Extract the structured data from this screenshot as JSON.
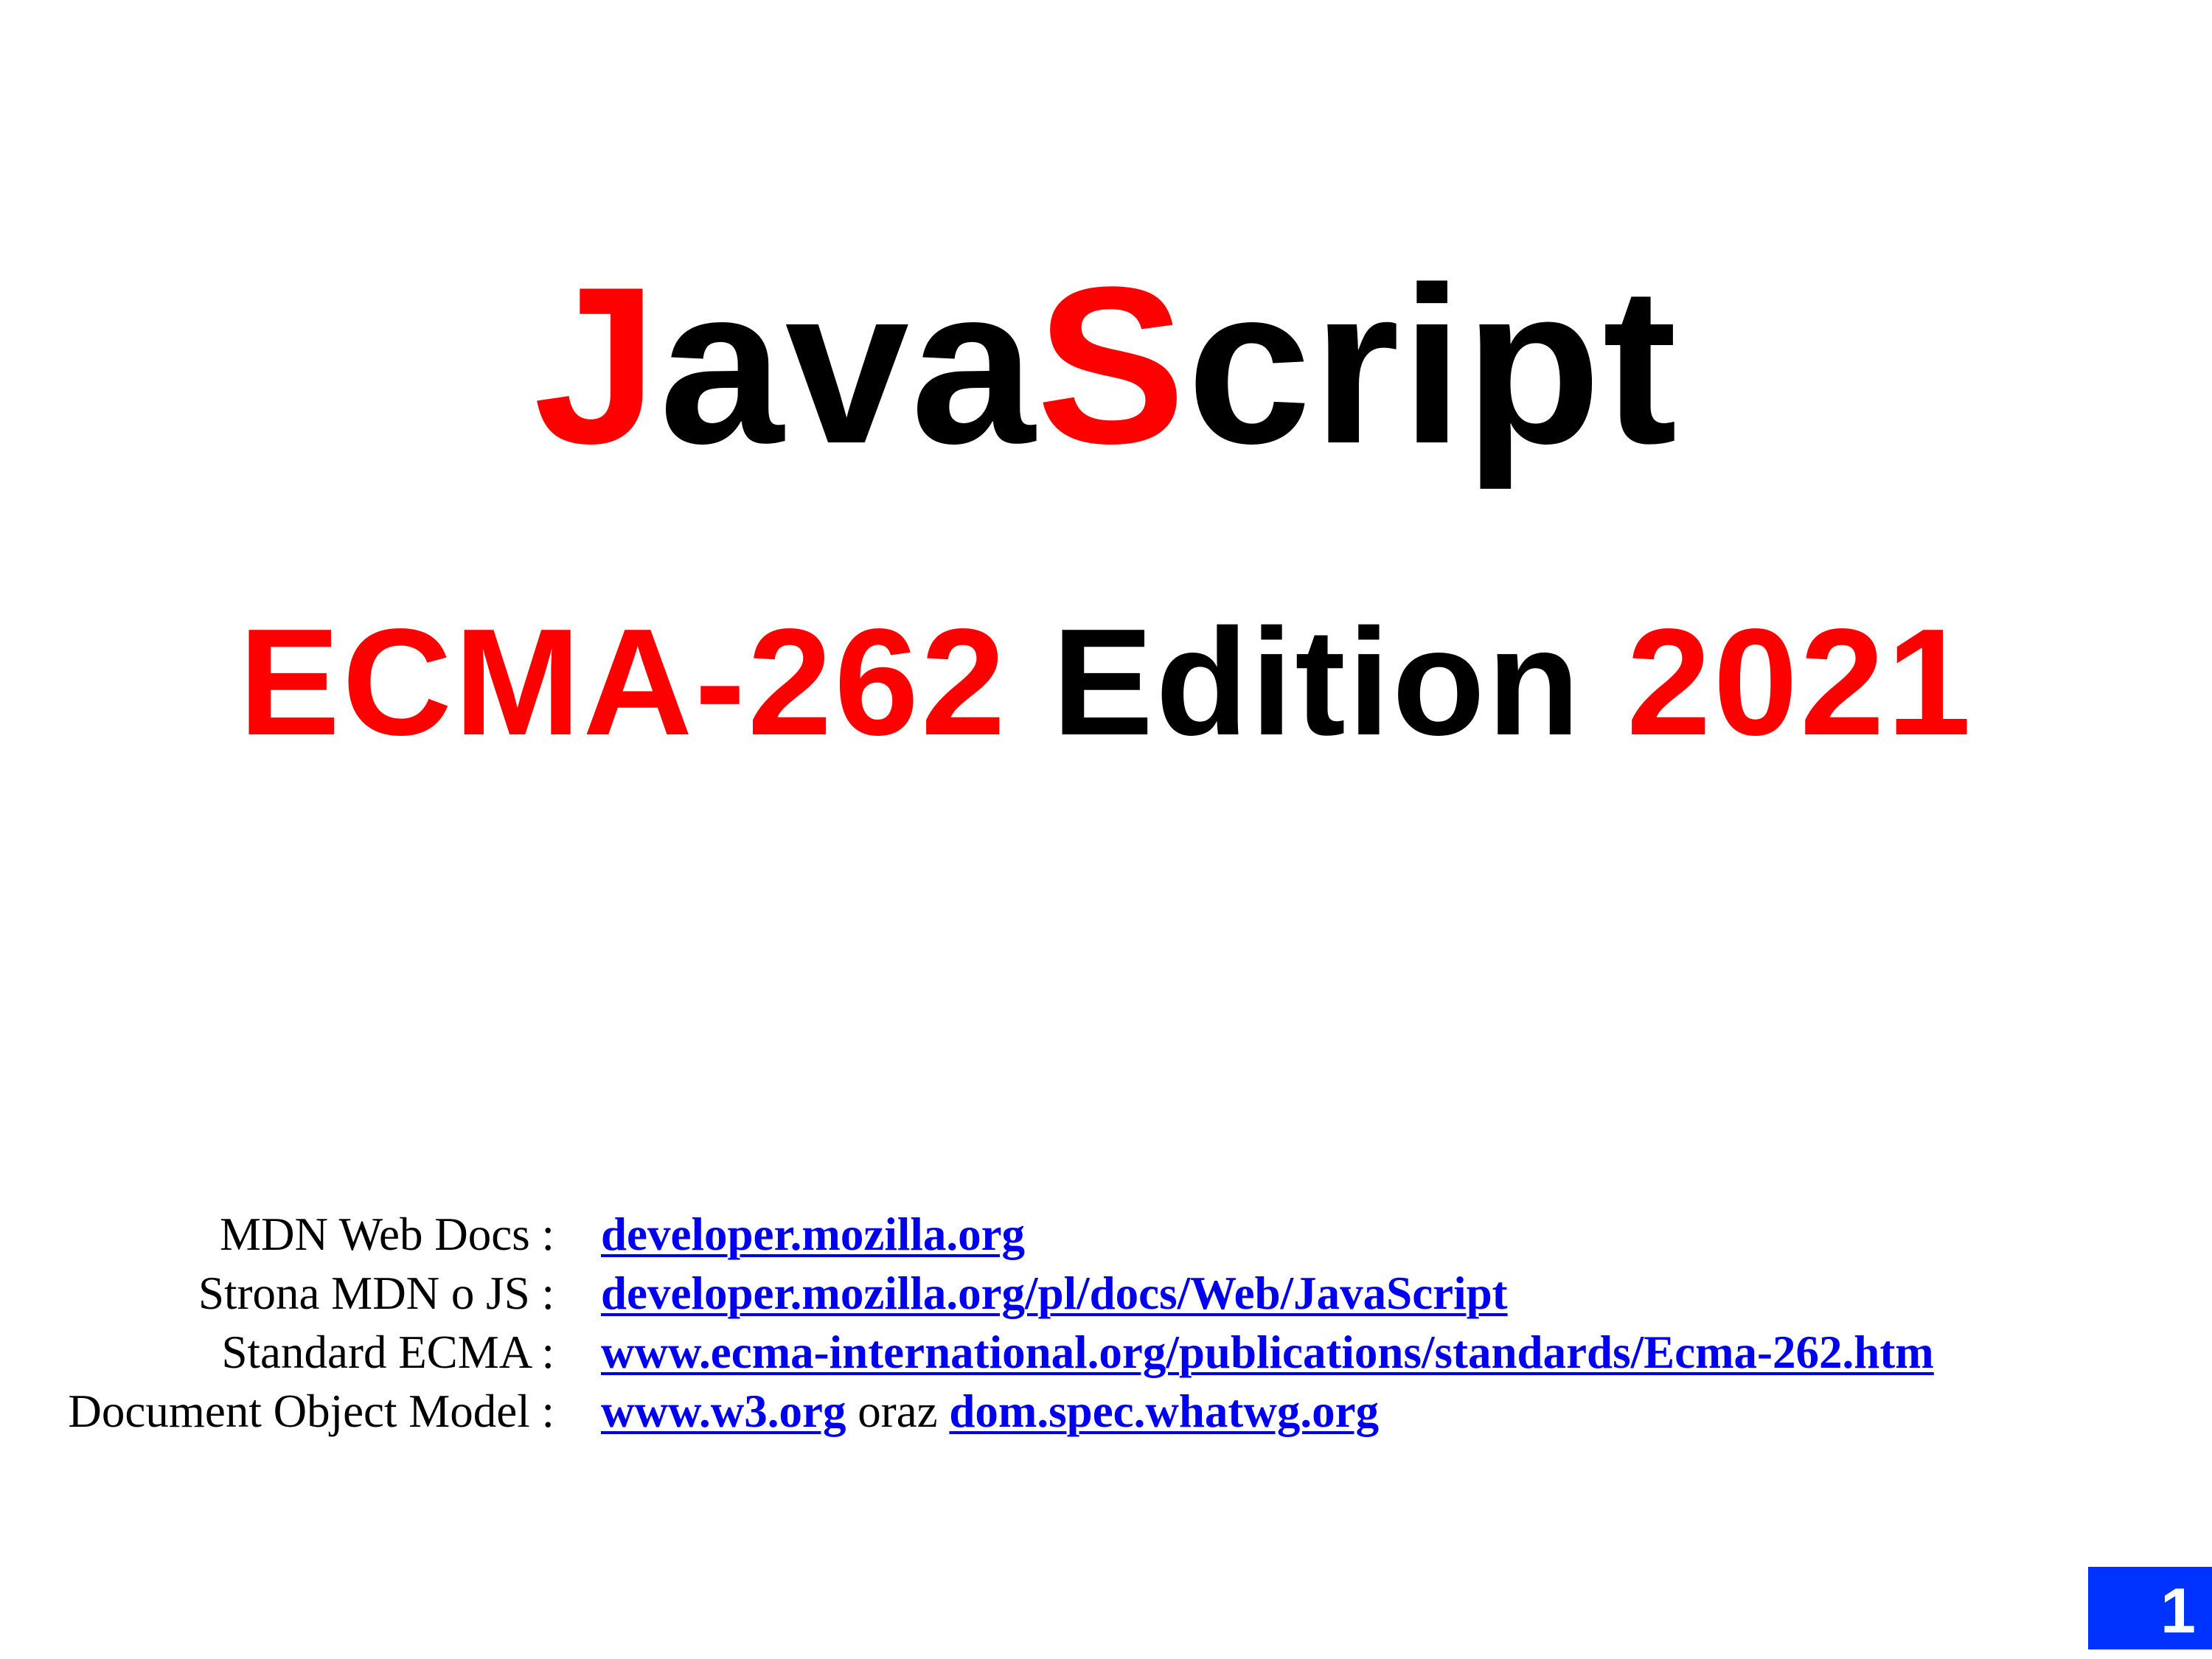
{
  "title": {
    "j": "J",
    "ava": "ava",
    "s": "S",
    "cript": "cript"
  },
  "subtitle": {
    "ecma": "ECMA-262",
    "edition": "Edition",
    "year": "2021"
  },
  "links": [
    {
      "label": "MDN Web Docs :",
      "url": "developer.mozilla.org"
    },
    {
      "label": "Strona MDN o JS :",
      "url": "developer.mozilla.org/pl/docs/Web/JavaScript"
    },
    {
      "label": "Standard ECMA :",
      "url": "www.ecma-international.org/publications/standards/Ecma-262.htm"
    },
    {
      "label": "Document Object Model :",
      "url": "www.w3.org",
      "connector": "oraz",
      "url2": "dom.spec.whatwg.org"
    }
  ],
  "page_number": "1",
  "colors": {
    "accent": "#ff0000",
    "text": "#000000",
    "link": "#0000ee",
    "page_badge": "#0033ff",
    "background": "#ffffff"
  }
}
